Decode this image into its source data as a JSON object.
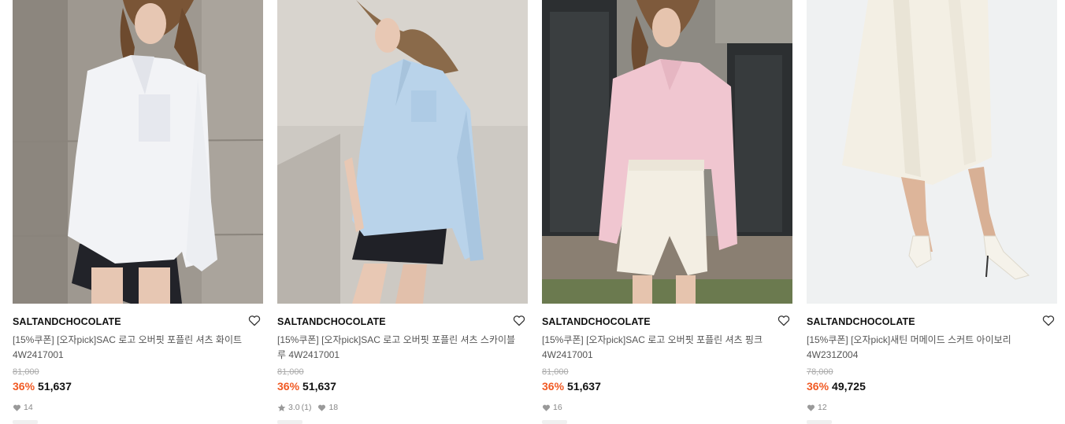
{
  "products": [
    {
      "brand": "SALTANDCHOCOLATE",
      "name": "[15%쿠폰] [오자pick]SAC 로고 오버핏 포플린 셔츠 화이트 4W2417001",
      "original_price": "81,000",
      "discount": "36%",
      "price": "51,637",
      "likes": "14",
      "rating": null,
      "photo": {
        "wall": "#9c968f",
        "wall2": "#b4aea6",
        "garment": "#f2f3f6",
        "bottom": "#24252a",
        "hair": "#7a5536",
        "skin": "#e7c7b3"
      }
    },
    {
      "brand": "SALTANDCHOCOLATE",
      "name": "[15%쿠폰] [오자pick]SAC 로고 오버핏 포플린 셔츠 스카이블루 4W2417001",
      "original_price": "81,000",
      "discount": "36%",
      "price": "51,637",
      "likes": "18",
      "rating": "3.0",
      "rating_count": "(1)",
      "photo": {
        "wall": "#c9c5bf",
        "wall2": "#dcd8d2",
        "garment": "#b9d3ea",
        "bottom": "#202127",
        "hair": "#8a6a4a",
        "skin": "#e8c8b4"
      }
    },
    {
      "brand": "SALTANDCHOCOLATE",
      "name": "[15%쿠폰] [오자pick]SAC 로고 오버핏 포플린 셔츠 핑크 4W2417001",
      "original_price": "81,000",
      "discount": "36%",
      "price": "51,637",
      "likes": "16",
      "rating": null,
      "photo": {
        "wall": "#8f8c84",
        "wall2": "#2d3033",
        "garment": "#f0c6d0",
        "bottom": "#f3eee3",
        "hair": "#7e5a3c",
        "skin": "#e6c4ae"
      }
    },
    {
      "brand": "SALTANDCHOCOLATE",
      "name": "[15%쿠폰] [오자pick]새틴 머메이드 스커트 아이보리 4W231Z004",
      "original_price": "78,000",
      "discount": "36%",
      "price": "49,725",
      "likes": "12",
      "rating": null,
      "photo": {
        "wall": "#eef0f1",
        "wall2": "#f6f7f8",
        "garment": "#f3efe4",
        "bottom": "#f5f2ea",
        "hair": "#000000",
        "skin": "#ddb59a"
      }
    }
  ],
  "colors": {
    "accent": "#f15a24",
    "brand_text": "#111111",
    "muted": "#888888"
  },
  "icons": {
    "wish": "heart-outline-icon",
    "likes": "heart-filled-icon",
    "rating": "star-icon"
  }
}
